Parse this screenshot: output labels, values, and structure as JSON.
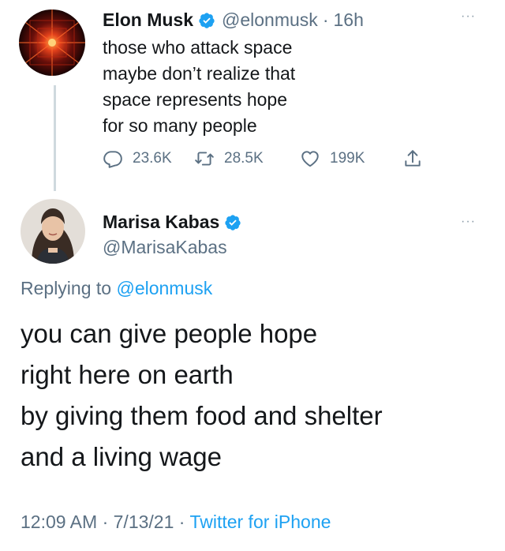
{
  "original_tweet": {
    "display_name": "Elon Musk",
    "handle": "@elonmusk",
    "separator": "·",
    "age": "16h",
    "text_lines": [
      "those who attack space",
      "maybe don’t realize that",
      "space represents hope",
      "for so many people"
    ],
    "reply_count": "23.6K",
    "retweet_count": "28.5K",
    "like_count": "199K",
    "more_icon": "more-dots-icon"
  },
  "reply_tweet": {
    "display_name": "Marisa Kabas",
    "handle": "@MarisaKabas",
    "replying_prefix": "Replying to",
    "replying_to": "@elonmusk",
    "text_lines": [
      "you can give people hope",
      "right here on earth",
      "by giving them food and shelter",
      "and a living wage"
    ],
    "time": "12:09 AM",
    "date": "7/13/21",
    "separator": "·",
    "source": "Twitter for iPhone",
    "more_icon": "more-dots-icon"
  },
  "colors": {
    "accent": "#1da1f2",
    "muted": "#5b7083",
    "text": "#14171a",
    "verified": "#1da1f2"
  }
}
